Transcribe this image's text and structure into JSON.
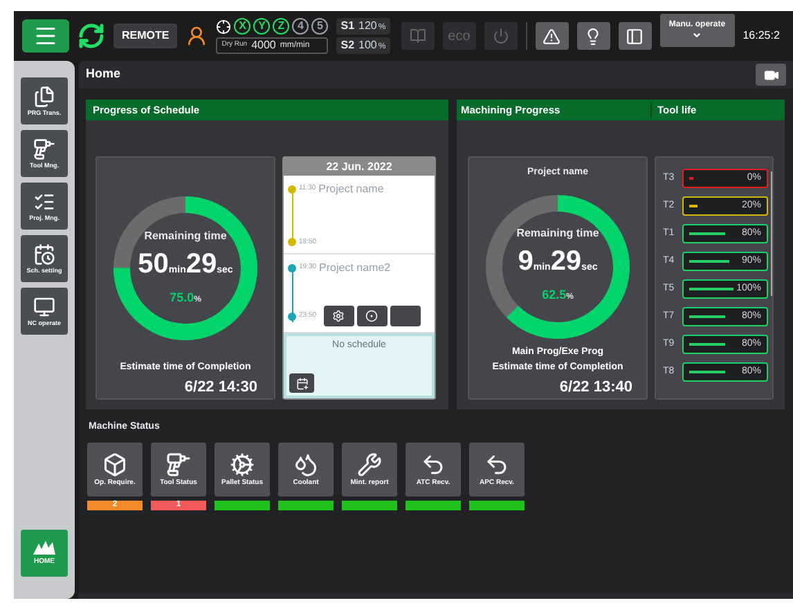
{
  "top_bar": {
    "mode": "REMOTE",
    "axes": [
      {
        "label": "X",
        "active": true
      },
      {
        "label": "Y",
        "active": true
      },
      {
        "label": "Z",
        "active": true
      },
      {
        "label": "4",
        "active": false
      },
      {
        "label": "5",
        "active": false
      }
    ],
    "dry_run": {
      "label": "Dry Run",
      "value": "4000",
      "unit": "mm/min"
    },
    "spindles": [
      {
        "name": "S1",
        "value": "120",
        "unit": "%"
      },
      {
        "name": "S2",
        "value": "100",
        "unit": "%"
      }
    ],
    "eco": "eco",
    "menu": "Manu. operate",
    "time": "16:25:2"
  },
  "sidebar": {
    "items": [
      {
        "label": "PRG Trans."
      },
      {
        "label": "Tool Mng."
      },
      {
        "label": "Proj. Mng."
      },
      {
        "label": "Sch. setting"
      },
      {
        "label": "NC operate"
      }
    ],
    "home": "HOME"
  },
  "page_title": "Home",
  "schedule": {
    "title": "Progress of Schedule",
    "remaining_label": "Remaining time",
    "minutes": "50",
    "min_unit": "min",
    "seconds": "29",
    "sec_unit": "sec",
    "percent": "75.0",
    "percent_unit": "%",
    "estimate_label": "Estimate time of Completion",
    "estimate": "6/22 14:30",
    "calendar": {
      "date": "22 Jun. 2022",
      "entries": [
        {
          "start": "11:30",
          "name": "Project name",
          "end": "18:50",
          "color": "#d4b800"
        },
        {
          "start": "19:30",
          "name": "Project name2",
          "end": "23:50",
          "color": "#1aa6b8"
        }
      ],
      "empty_text": "No schedule"
    }
  },
  "machining": {
    "title": "Machining Progress",
    "project": "Project name",
    "remaining_label": "Remaining time",
    "minutes": "9",
    "min_unit": "min",
    "seconds": "29",
    "sec_unit": "sec",
    "percent": "62.5",
    "percent_unit": "%",
    "program": "Main Prog/Exe Prog",
    "estimate_label": "Estimate time of Completion",
    "estimate": "6/22 13:40"
  },
  "tool_life": {
    "title": "Tool life",
    "tools": [
      {
        "name": "T3",
        "reading": "0%",
        "color": "#e02020"
      },
      {
        "name": "T2",
        "reading": "20%",
        "color": "#d4b800"
      },
      {
        "name": "T1",
        "reading": "80%",
        "color": "#22cc66"
      },
      {
        "name": "T4",
        "reading": "90%",
        "color": "#22cc66"
      },
      {
        "name": "T5",
        "reading": "100%",
        "color": "#22cc66"
      },
      {
        "name": "T7",
        "reading": "80%",
        "color": "#22cc66"
      },
      {
        "name": "T9",
        "reading": "80%",
        "color": "#22cc66"
      },
      {
        "name": "T8",
        "reading": "80%",
        "color": "#22cc66"
      }
    ]
  },
  "machine_status": {
    "title": "Machine Status",
    "tiles": [
      {
        "kind": "machine",
        "label": "Op. Require.",
        "badge": "2",
        "color": "#f28a2a"
      },
      {
        "kind": "tool",
        "label": "Tool Status",
        "badge": "1",
        "color": "#f05a5a"
      },
      {
        "kind": "pallet",
        "label": "Pallet Status",
        "color": "#22c01a"
      },
      {
        "kind": "coolant",
        "label": "Coolant",
        "color": "#22c01a"
      },
      {
        "kind": "wrench",
        "label": "Mint. report",
        "color": "#22c01a"
      },
      {
        "kind": "atc",
        "label": "ATC Recv.",
        "color": "#22c01a"
      },
      {
        "kind": "apc",
        "label": "APC Recv.",
        "color": "#22c01a"
      }
    ]
  }
}
